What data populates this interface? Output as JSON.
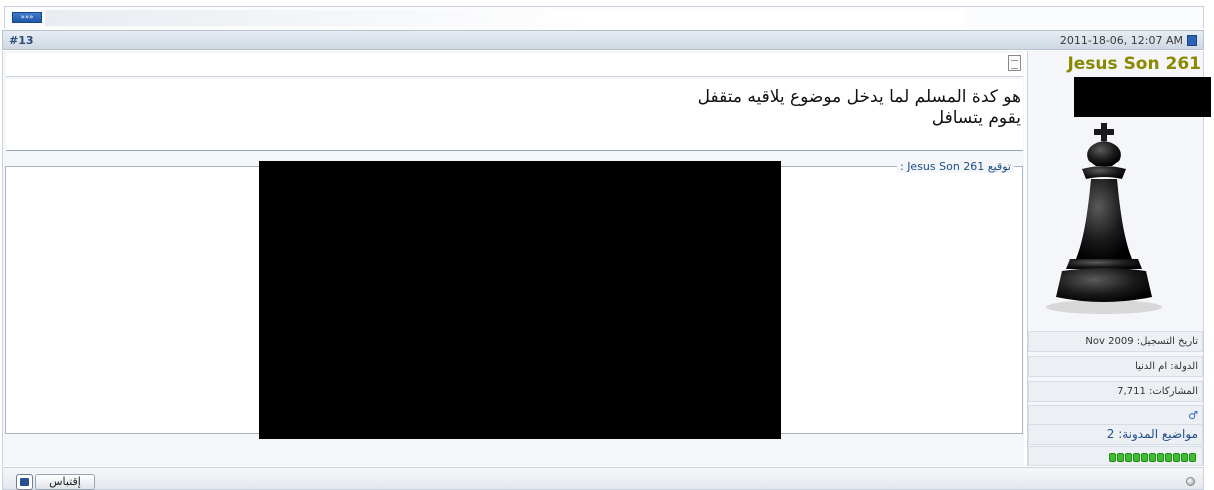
{
  "nav": {
    "next_label": "»»»"
  },
  "post": {
    "number": "#13",
    "date": "2011-18-06, 12:07 AM",
    "message_lines": [
      "هو كدة المسلم لما يدخل موضوع يلاقيه متقفل",
      "يقوم يتسافل"
    ],
    "signature_legend": "توقيع Jesus Son 261 :"
  },
  "user": {
    "username": "Jesus Son 261",
    "join_date": "تاريخ التسجيل: Nov 2009",
    "country": "الدولة: ام الدنيا",
    "posts": "المشاركات: 7,711",
    "blog_topics": "مواضيع المدونة: 2",
    "gender_icon": "male-icon",
    "reputation_dots": 11
  },
  "footer": {
    "quote_label": "إقتباس"
  },
  "colors": {
    "username": "#8a8a00",
    "link": "#1e4f8a",
    "reputation": "#3fbf2f"
  }
}
